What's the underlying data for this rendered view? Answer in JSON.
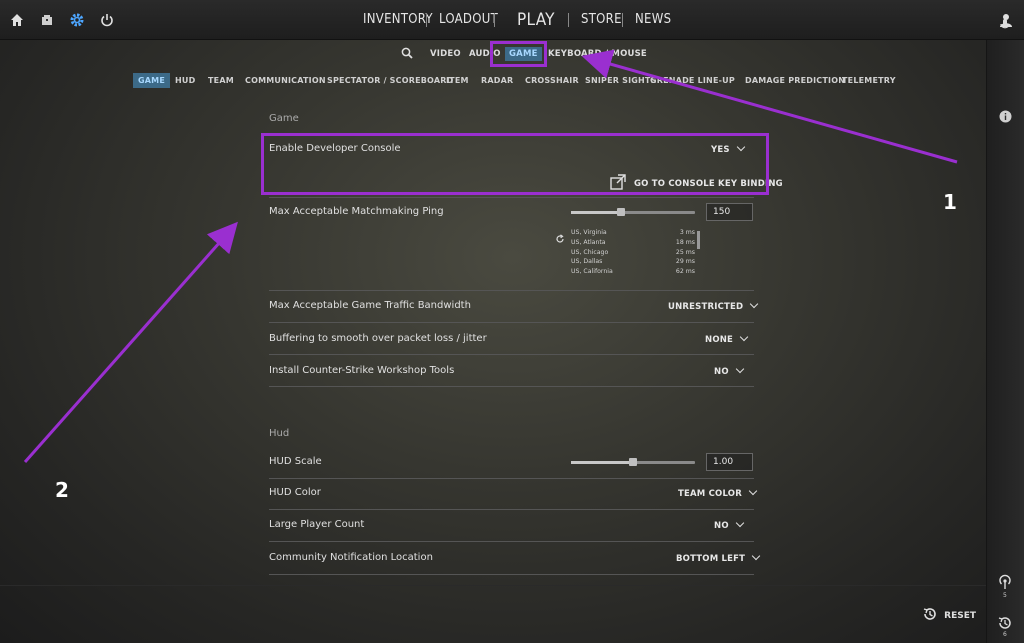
{
  "topbar": {
    "icons": [
      "home-icon",
      "inventory-box-icon",
      "settings-gear-icon",
      "power-icon"
    ],
    "nav": [
      "INVENTORY",
      "LOADOUT",
      "PLAY",
      "STORE",
      "NEWS"
    ],
    "user_icon": "user-icon"
  },
  "subnav": {
    "items": [
      "VIDEO",
      "AUDIO",
      "GAME",
      "KEYBOARD / MOUSE"
    ],
    "active": "GAME"
  },
  "tabs": {
    "items": [
      "GAME",
      "HUD",
      "TEAM",
      "COMMUNICATION",
      "SPECTATOR / SCOREBOARD",
      "ITEM",
      "RADAR",
      "CROSSHAIR",
      "SNIPER SIGHTS",
      "GRENADE LINE-UP",
      "DAMAGE PREDICTION",
      "TELEMETRY"
    ],
    "active": "GAME"
  },
  "game_section": {
    "title": "Game",
    "dev_console": {
      "label": "Enable Developer Console",
      "value": "YES",
      "link": "GO TO CONSOLE KEY BINDING"
    },
    "matchmaking_ping": {
      "label": "Max Acceptable Matchmaking Ping",
      "value": "150",
      "slider_fraction": 0.4,
      "servers": [
        {
          "loc": "US, Virginia",
          "ms": "3 ms"
        },
        {
          "loc": "US, Atlanta",
          "ms": "18 ms"
        },
        {
          "loc": "US, Chicago",
          "ms": "25 ms"
        },
        {
          "loc": "US, Dallas",
          "ms": "29 ms"
        },
        {
          "loc": "US, California",
          "ms": "62 ms"
        }
      ]
    },
    "bandwidth": {
      "label": "Max Acceptable Game Traffic Bandwidth",
      "value": "UNRESTRICTED"
    },
    "buffering": {
      "label": "Buffering to smooth over packet loss / jitter",
      "value": "NONE"
    },
    "workshop": {
      "label": "Install Counter-Strike Workshop Tools",
      "value": "NO"
    }
  },
  "hud_section": {
    "title": "Hud",
    "scale": {
      "label": "HUD Scale",
      "value": "1.00",
      "slider_fraction": 0.5
    },
    "color": {
      "label": "HUD Color",
      "value": "TEAM COLOR"
    },
    "large_player": {
      "label": "Large Player Count",
      "value": "NO"
    },
    "notification": {
      "label": "Community Notification Location",
      "value": "BOTTOM LEFT"
    }
  },
  "annotations": {
    "one": "1",
    "two": "2"
  },
  "rail": {
    "counts": [
      "5",
      "6"
    ]
  },
  "reset_label": "RESET",
  "colors": {
    "accent": "#3c6a88",
    "highlight": "#9a2fd0"
  }
}
